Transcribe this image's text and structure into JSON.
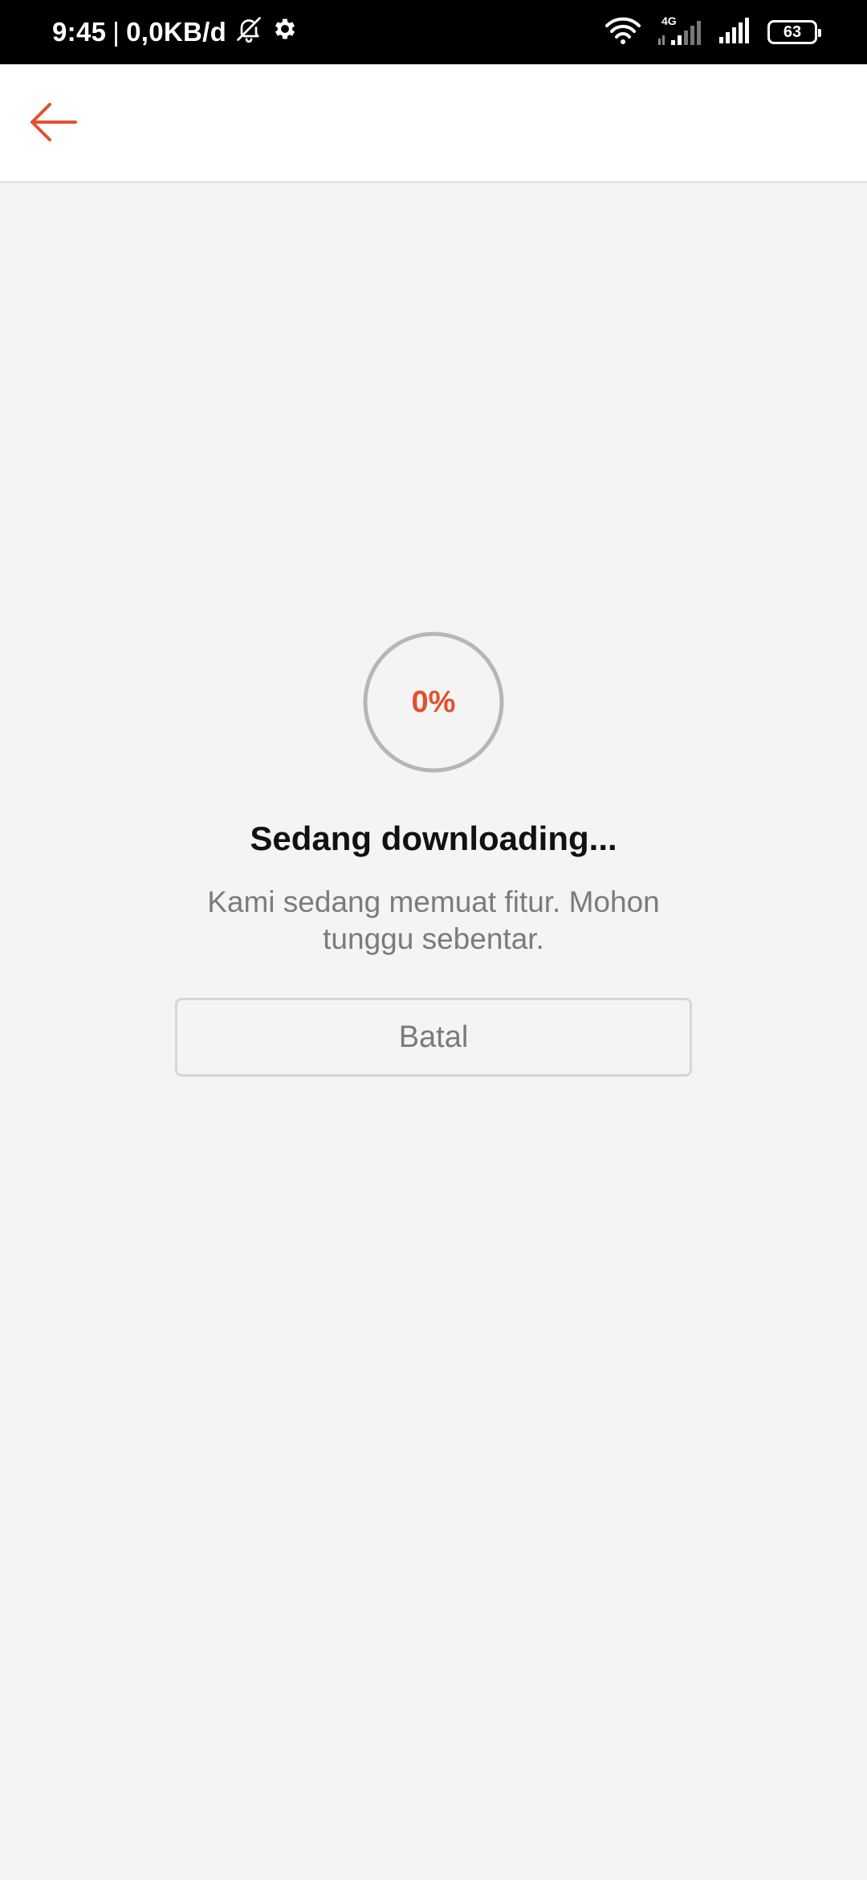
{
  "status_bar": {
    "time": "9:45",
    "separator": "|",
    "network_speed": "0,0KB/d",
    "network_type": "4G",
    "battery_level": "63",
    "icons": [
      "bell-off-icon",
      "gear-icon",
      "wifi-icon",
      "signal-4g-icon",
      "signal-icon",
      "battery-icon"
    ]
  },
  "app_bar": {
    "back_icon": "arrow-left-icon",
    "accent_color": "#e3502f"
  },
  "download": {
    "progress_percent": 0,
    "progress_label": "0%",
    "title": "Sedang downloading...",
    "message": "Kami sedang memuat fitur. Mohon tunggu sebentar.",
    "cancel_label": "Batal"
  }
}
